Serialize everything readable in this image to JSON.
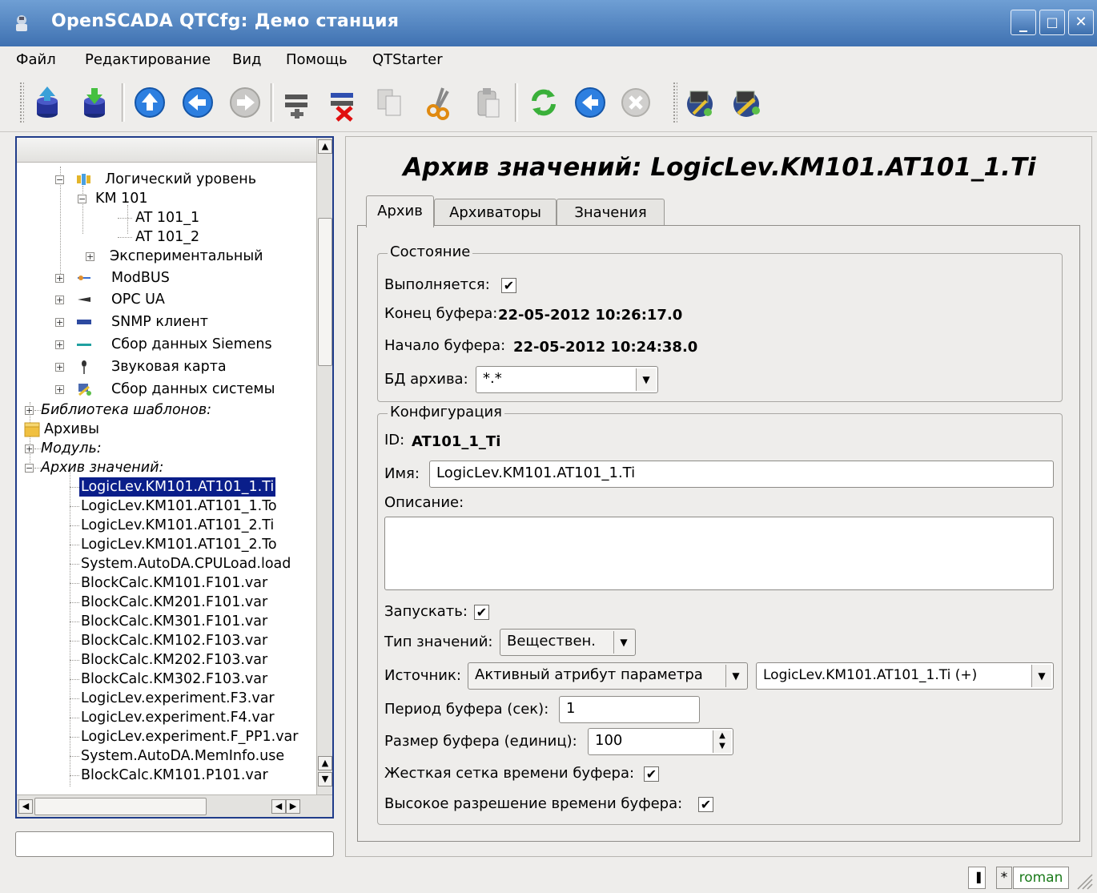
{
  "window": {
    "title": "OpenSCADA QTCfg: Демо станция",
    "controls": {
      "minimize": "_",
      "maximize": "□",
      "close": "✕"
    }
  },
  "menu": {
    "items": [
      {
        "label": "Файл"
      },
      {
        "label": "Редактирование"
      },
      {
        "label": "Вид"
      },
      {
        "label": "Помощь"
      },
      {
        "label": "QTStarter"
      }
    ]
  },
  "toolbar": {
    "buttons": [
      "db-load-icon",
      "db-save-icon",
      "up-icon",
      "back-icon",
      "forward-icon",
      "add-item-icon",
      "delete-item-icon",
      "copy-icon",
      "cut-icon",
      "paste-icon",
      "refresh-icon",
      "start-icon",
      "stop-icon",
      "remote-station-icon",
      "remote-update-icon"
    ]
  },
  "tree": {
    "rows": [
      {
        "label": "Логический уровень"
      },
      {
        "label": "KM 101"
      },
      {
        "label": "AT 101_1"
      },
      {
        "label": "AT 101_2"
      },
      {
        "label": "Экспериментальный"
      },
      {
        "label": "ModBUS"
      },
      {
        "label": "OPC UA"
      },
      {
        "label": "SNMP клиент"
      },
      {
        "label": "Сбор данных Siemens"
      },
      {
        "label": "Звуковая карта"
      },
      {
        "label": "Сбор данных системы"
      },
      {
        "label": "Библиотека шаблонов:"
      },
      {
        "label": "Архивы"
      },
      {
        "label": "Модуль:"
      },
      {
        "label": "Архив значений:"
      },
      {
        "label": "LogicLev.KM101.AT101_1.Ti"
      },
      {
        "label": "LogicLev.KM101.AT101_1.To"
      },
      {
        "label": "LogicLev.KM101.AT101_2.Ti"
      },
      {
        "label": "LogicLev.KM101.AT101_2.To"
      },
      {
        "label": "System.AutoDA.CPULoad.load"
      },
      {
        "label": "BlockCalc.KM101.F101.var"
      },
      {
        "label": "BlockCalc.KM201.F101.var"
      },
      {
        "label": "BlockCalc.KM301.F101.var"
      },
      {
        "label": "BlockCalc.KM102.F103.var"
      },
      {
        "label": "BlockCalc.KM202.F103.var"
      },
      {
        "label": "BlockCalc.KM302.F103.var"
      },
      {
        "label": "LogicLev.experiment.F3.var"
      },
      {
        "label": "LogicLev.experiment.F4.var"
      },
      {
        "label": "LogicLev.experiment.F_PP1.var"
      },
      {
        "label": "System.AutoDA.MemInfo.use"
      },
      {
        "label": "BlockCalc.KM101.P101.var"
      }
    ]
  },
  "page": {
    "title": "Архив значений: LogicLev.KM101.AT101_1.Ti",
    "tabs": [
      {
        "label": "Архив"
      },
      {
        "label": "Архиваторы"
      },
      {
        "label": "Значения"
      }
    ]
  },
  "state": {
    "group_title": "Состояние",
    "running_label": "Выполняется:",
    "running": true,
    "buf_end_label": "Конец буфера:",
    "buf_end_value": "22-05-2012 10:26:17.0",
    "buf_begin_label": "Начало буфера:",
    "buf_begin_value": "22-05-2012 10:24:38.0",
    "db_label": "БД архива:",
    "db_value": "*.*"
  },
  "config": {
    "group_title": "Конфигурация",
    "id_label": "ID:",
    "id_value": "AT101_1_Ti",
    "name_label": "Имя:",
    "name_value": "LogicLev.KM101.AT101_1.Ti",
    "descr_label": "Описание:",
    "descr_value": "",
    "start_label": "Запускать:",
    "start": true,
    "type_label": "Тип значений:",
    "type_value": "Веществен.",
    "source_label": "Источник:",
    "source_mode": "Активный атрибут параметра",
    "source_value": "LogicLev.KM101.AT101_1.Ti (+)",
    "period_label": "Период буфера (сек):",
    "period_value": "1",
    "size_label": "Размер буфера (единиц):",
    "size_value": "100",
    "hard_grid_label": "Жесткая сетка времени буфера:",
    "hard_grid": true,
    "high_res_label": "Высокое разрешение времени буфера:",
    "high_res": true
  },
  "status": {
    "modified": "*",
    "user": "roman"
  }
}
